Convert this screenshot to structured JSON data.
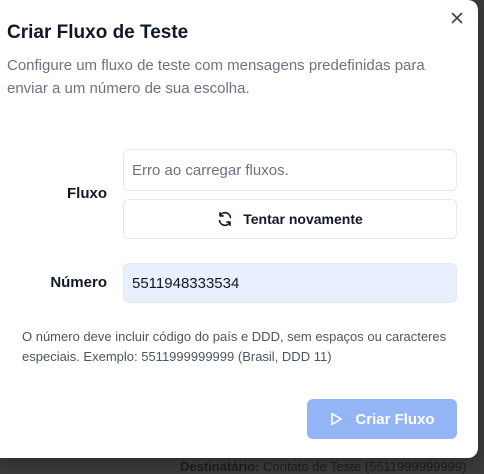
{
  "dialog": {
    "title": "Criar Fluxo de Teste",
    "description": "Configure um fluxo de teste com mensagens predefinidas para enviar a um número de sua escolha."
  },
  "form": {
    "fluxo_label": "Fluxo",
    "fluxo_placeholder": "Erro ao carregar fluxos.",
    "retry_label": "Tentar novamente",
    "numero_label": "Número",
    "numero_value": "5511948333534",
    "hint": "O número deve incluir código do país e DDD, sem espaços ou caracteres especiais. Exemplo: 5511999999999 (Brasil, DDD 11)",
    "submit_label": "Criar Fluxo"
  },
  "backdrop": {
    "recipient_label": "Destinatário:",
    "recipient_value": "Contato de Teste (5511999999999)"
  },
  "icons": {
    "close": "close-icon",
    "retry": "refresh-icon",
    "submit": "play-icon"
  },
  "colors": {
    "submit_bg": "#93b4f5",
    "input_autofill_bg": "#e8f0fe"
  }
}
